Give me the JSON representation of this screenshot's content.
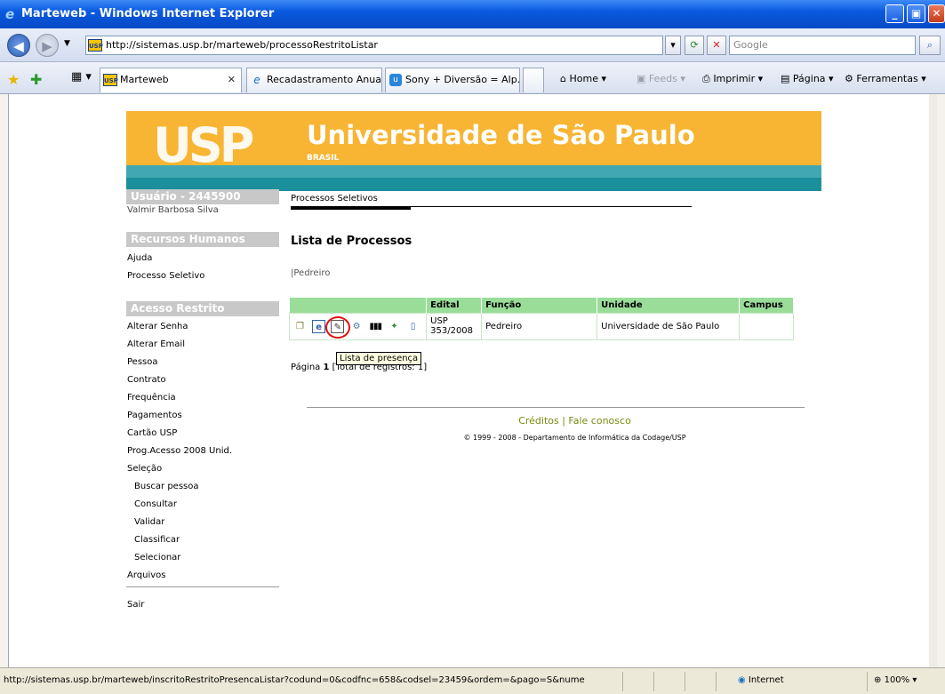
{
  "window": {
    "title": "Marteweb - Windows Internet Explorer"
  },
  "address": {
    "url": "http://sistemas.usp.br/marteweb/processoRestritoListar",
    "search_placeholder": "Google"
  },
  "tabs": [
    {
      "label": "Marteweb"
    },
    {
      "label": "Recadastramento Anual"
    },
    {
      "label": "Sony + Diversão = Alp..."
    }
  ],
  "commands": {
    "home": "Home",
    "feeds": "Feeds",
    "print": "Imprimir",
    "page": "Página",
    "tools": "Ferramentas"
  },
  "banner": {
    "logo": "USP",
    "title": "Universidade de São Paulo",
    "subtitle": "BRASIL"
  },
  "user": {
    "header": "Usuário - 2445900",
    "name": "Valmir Barbosa Silva"
  },
  "rh": {
    "header": "Recursos Humanos",
    "items": [
      "Ajuda",
      "Processo Seletivo"
    ]
  },
  "acesso": {
    "header": "Acesso Restrito",
    "items": [
      "Alterar Senha",
      "Alterar Email",
      "Pessoa",
      "Contrato",
      "Frequência",
      "Pagamentos",
      "Cartão USP",
      "Prog.Acesso 2008 Unid.",
      "Seleção"
    ],
    "subitems": [
      "Buscar pessoa",
      "Consultar",
      "Validar",
      "Classificar",
      "Selecionar"
    ],
    "arquivos": "Arquivos"
  },
  "sair": "Sair",
  "content": {
    "breadcrumb": "Processos Seletivos",
    "heading": "Lista de Processos",
    "filter": "|Pedreiro",
    "columns": [
      "",
      "Edital",
      "Função",
      "Unidade",
      "Campus"
    ],
    "row": {
      "edital": "USP 353/2008",
      "funcao": "Pedreiro",
      "unidade": "Universidade de São Paulo",
      "campus": ""
    },
    "tooltip": "Lista de presença",
    "pager_prefix": "Página",
    "pager_page": "1",
    "pager_suffix": "[Total de registros: 1]"
  },
  "footer": {
    "links": "Créditos | Fale conosco",
    "copyright": "© 1999 - 2008 - Departamento de Informática da Codage/USP"
  },
  "status": {
    "url": "http://sistemas.usp.br/marteweb/inscritoRestritoPresencaListar?codund=0&codfnc=658&codsel=23459&ordem=&pago=S&nume",
    "zone": "Internet",
    "zoom": "100%"
  }
}
